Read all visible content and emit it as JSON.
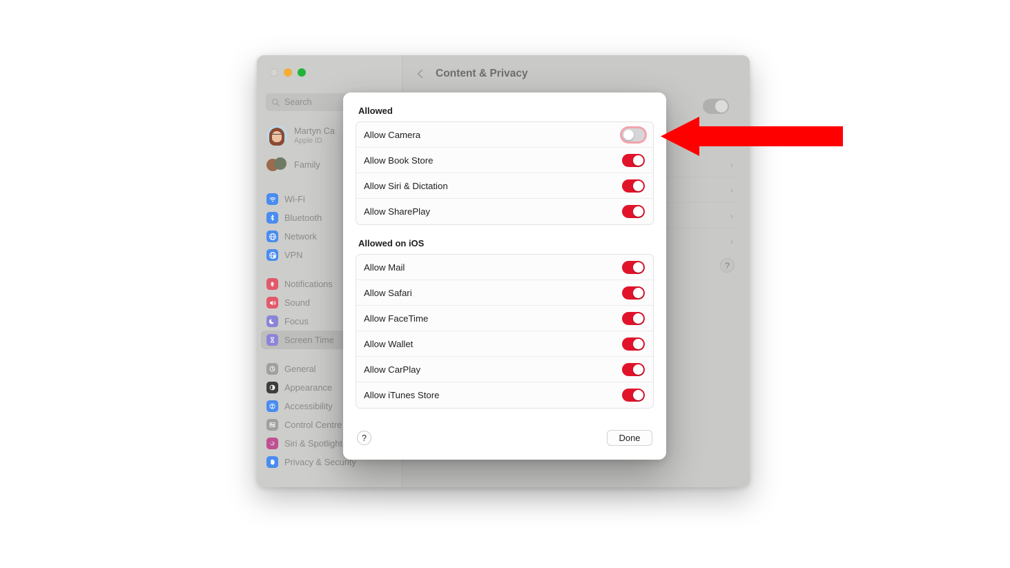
{
  "window": {
    "traffic_lights": [
      "close",
      "minimize",
      "maximize"
    ],
    "search": {
      "placeholder": "Search",
      "value": "",
      "icon": "search-icon"
    },
    "account": {
      "name": "Martyn Ca",
      "subtitle": "Apple ID",
      "avatar": "user-avatar"
    },
    "family": {
      "label": "Family",
      "icon": "family-avatars"
    },
    "sidebar_groups": [
      {
        "items": [
          {
            "label": "Wi-Fi",
            "icon": "wifi-icon",
            "color": "#4a8cf0"
          },
          {
            "label": "Bluetooth",
            "icon": "bluetooth-icon",
            "color": "#4a8cf0"
          },
          {
            "label": "Network",
            "icon": "globe-icon",
            "color": "#4a8cf0"
          },
          {
            "label": "VPN",
            "icon": "vpn-globe-icon",
            "color": "#4a8cf0"
          }
        ]
      },
      {
        "items": [
          {
            "label": "Notifications",
            "icon": "bell-icon",
            "color": "#e2596a"
          },
          {
            "label": "Sound",
            "icon": "speaker-icon",
            "color": "#e2596a"
          },
          {
            "label": "Focus",
            "icon": "moon-icon",
            "color": "#8b85d8"
          },
          {
            "label": "Screen Time",
            "icon": "hourglass-icon",
            "color": "#8b85d8",
            "selected": true
          }
        ]
      },
      {
        "items": [
          {
            "label": "General",
            "icon": "gear-icon",
            "color": "#a0a0a0"
          },
          {
            "label": "Appearance",
            "icon": "appearance-icon",
            "color": "#3d3d3d"
          },
          {
            "label": "Accessibility",
            "icon": "accessibility-icon",
            "color": "#4a8cf0"
          },
          {
            "label": "Control Centre",
            "icon": "control-centre-icon",
            "color": "#a0a0a0"
          },
          {
            "label": "Siri & Spotlight",
            "icon": "siri-icon",
            "color": "#c0508f"
          },
          {
            "label": "Privacy & Security",
            "icon": "hand-icon",
            "color": "#4a8cf0"
          }
        ]
      }
    ],
    "header": {
      "back_icon": "chevron-left-icon",
      "title": "Content & Privacy"
    },
    "behind": {
      "toggle_state": "on",
      "chevrons": [
        "chevron-right-icon",
        "chevron-right-icon",
        "chevron-right-icon",
        "chevron-right-icon"
      ],
      "help_label": "?"
    }
  },
  "sheet": {
    "groups": [
      {
        "title": "Allowed",
        "rows": [
          {
            "label": "Allow Camera",
            "state": "off",
            "focused": true
          },
          {
            "label": "Allow Book Store",
            "state": "on",
            "focused": false
          },
          {
            "label": "Allow Siri & Dictation",
            "state": "on",
            "focused": false
          },
          {
            "label": "Allow SharePlay",
            "state": "on",
            "focused": false
          }
        ]
      },
      {
        "title": "Allowed on iOS",
        "rows": [
          {
            "label": "Allow Mail",
            "state": "on",
            "focused": false
          },
          {
            "label": "Allow Safari",
            "state": "on",
            "focused": false
          },
          {
            "label": "Allow FaceTime",
            "state": "on",
            "focused": false
          },
          {
            "label": "Allow Wallet",
            "state": "on",
            "focused": false
          },
          {
            "label": "Allow CarPlay",
            "state": "on",
            "focused": false
          },
          {
            "label": "Allow iTunes Store",
            "state": "on",
            "focused": false
          }
        ]
      }
    ],
    "footer": {
      "help_label": "?",
      "done_label": "Done"
    }
  },
  "annotation": {
    "arrow": "left-pointing-arrow",
    "color": "#ff0000"
  },
  "colors": {
    "toggle_on": "#e1132a",
    "toggle_off": "#d6d6d8",
    "accent_red": "#ff0000"
  }
}
